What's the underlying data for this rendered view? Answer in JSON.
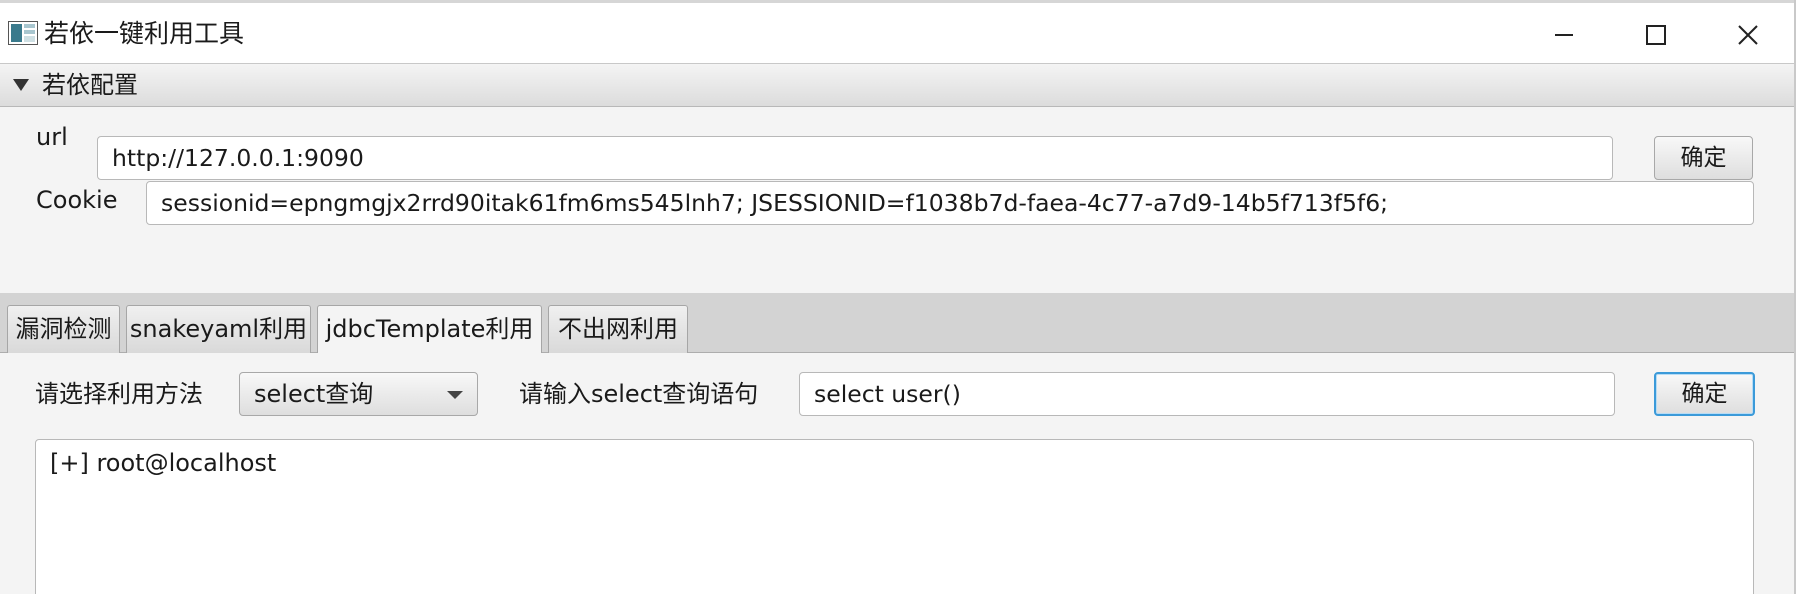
{
  "window": {
    "title": "若依一键利用工具",
    "icons": {
      "app": "app-icon",
      "minimize": "minimize-icon",
      "maximize": "maximize-icon",
      "close": "close-icon"
    }
  },
  "config_pane": {
    "title": "若依配置",
    "expanded": true,
    "url_label": "url",
    "url_value": "http://127.0.0.1:9090",
    "url_confirm": "确定",
    "cookie_label": "Cookie",
    "cookie_value": "sessionid=epngmgjx2rrd90itak61fm6ms545lnh7; JSESSIONID=f1038b7d-faea-4c77-a7d9-14b5f713f5f6;"
  },
  "tabs": [
    {
      "label": "漏洞检测",
      "active": false
    },
    {
      "label": "snakeyaml利用",
      "active": false
    },
    {
      "label": "jdbcTemplate利用",
      "active": true
    },
    {
      "label": "不出网利用",
      "active": false
    }
  ],
  "jdbc": {
    "method_label": "请选择利用方法",
    "method_selected": "select查询",
    "query_label": "请输入select查询语句",
    "query_value": "select user()",
    "confirm": "确定",
    "output": "[+] root@localhost"
  },
  "colors": {
    "focus_border": "#3b9ad9",
    "pane_bg": "#f4f4f4",
    "tab_bar_bg": "#d3d3d3"
  }
}
